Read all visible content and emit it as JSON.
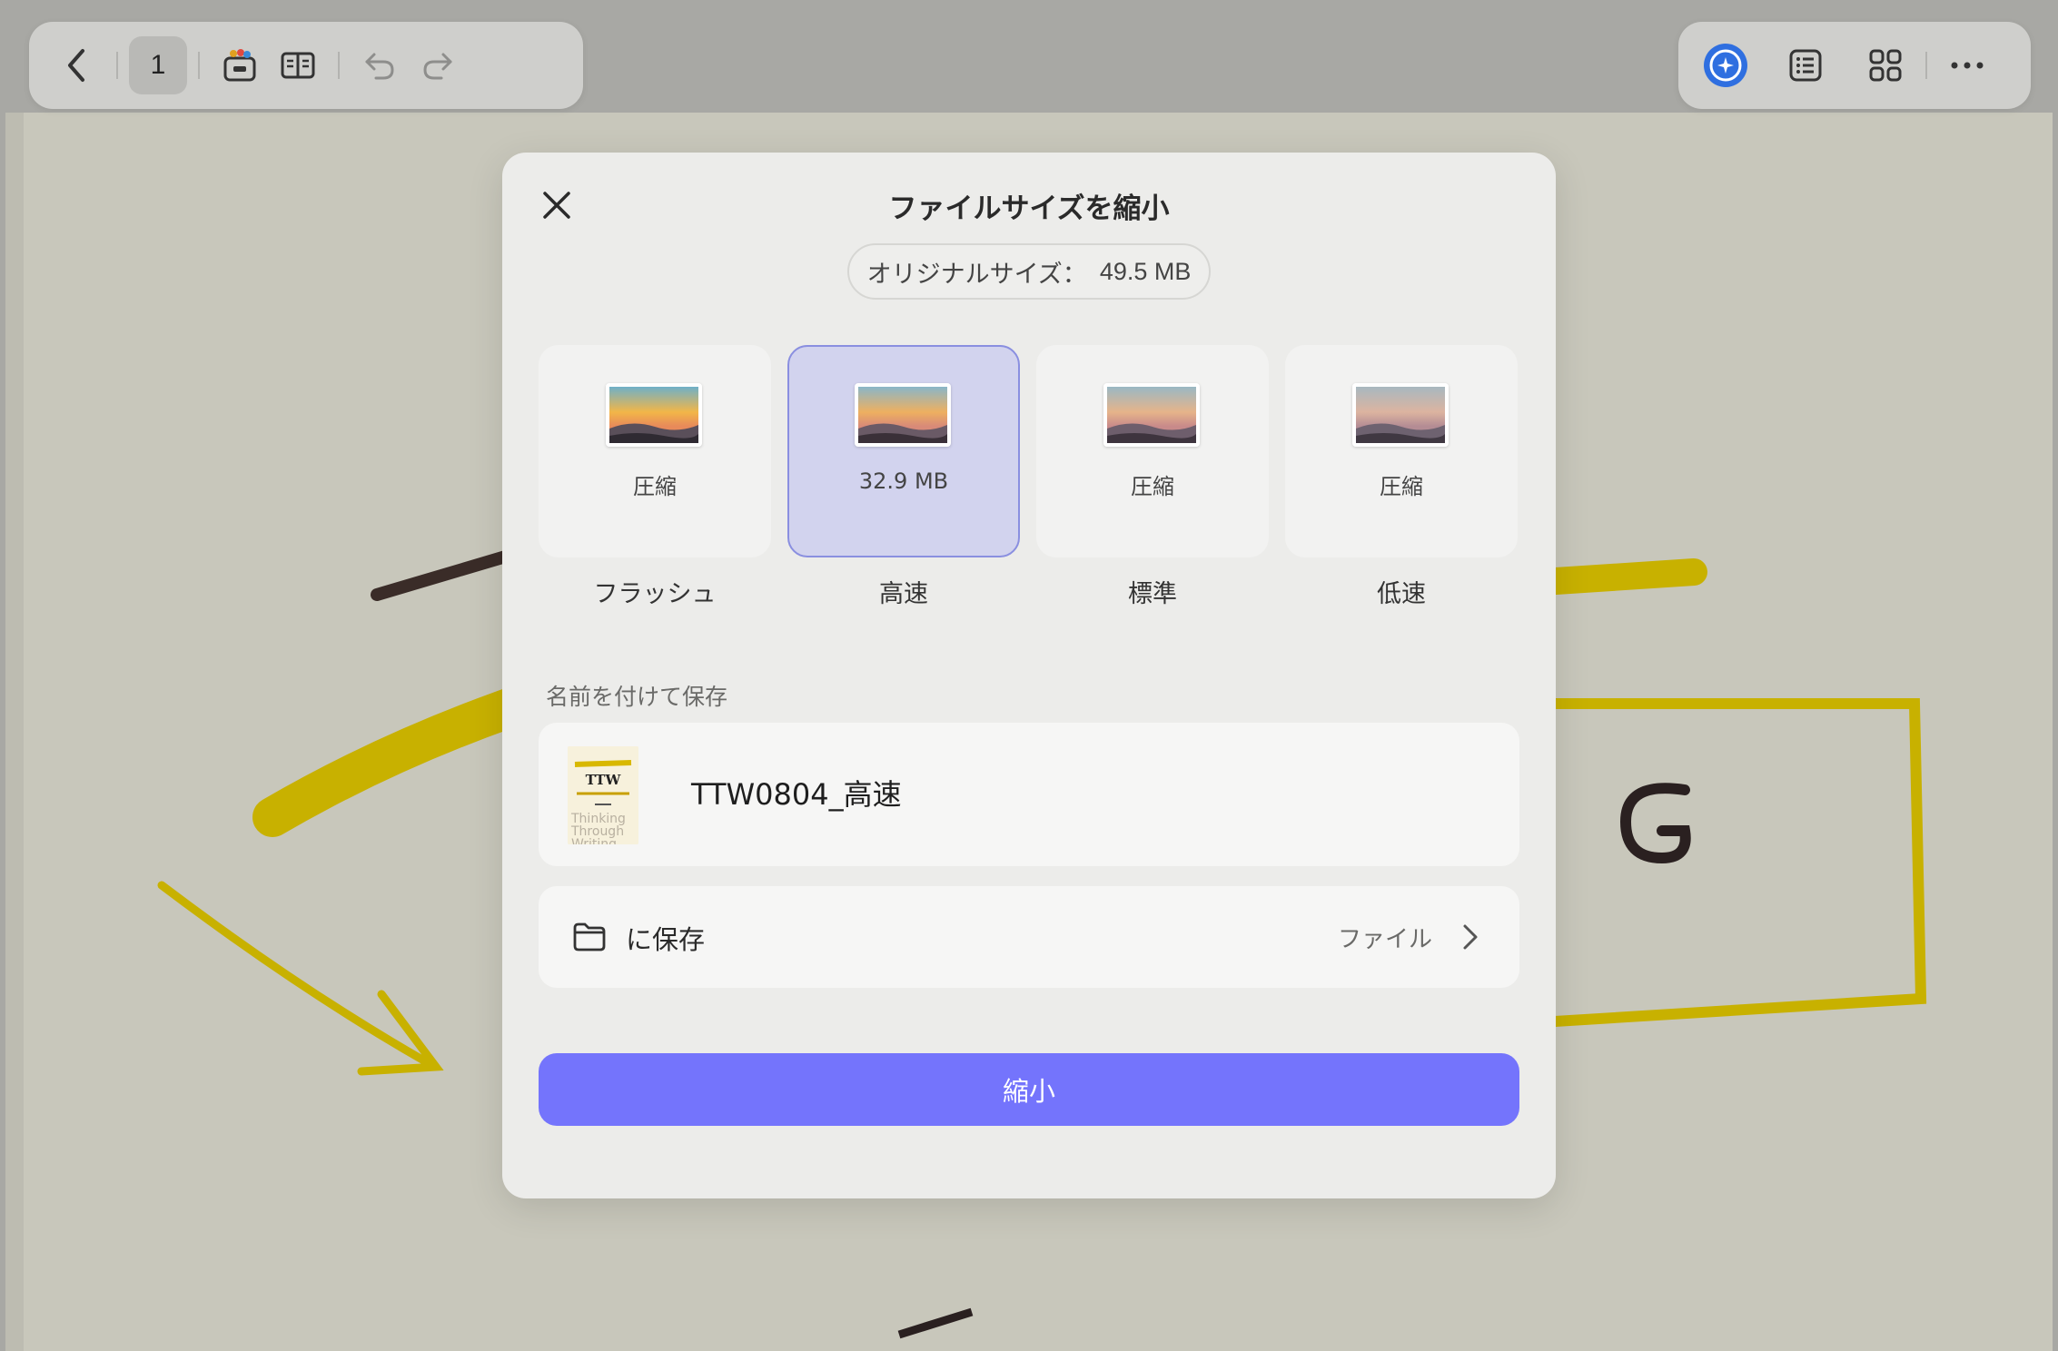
{
  "toolbar": {
    "page_number": "1",
    "icons": [
      "back-icon",
      "tray-icon",
      "book-icon",
      "undo-icon",
      "redo-icon",
      "ai-assistant-icon",
      "list-icon",
      "grid-icon",
      "more-icon"
    ]
  },
  "dialog": {
    "title": "ファイルサイズを縮小",
    "original_size_label": "オリジナルサイズ：",
    "original_size_value": "49.5 MB",
    "options": [
      {
        "size": "圧縮",
        "name": "フラッシュ",
        "selected": false
      },
      {
        "size": "32.9 MB",
        "name": "高速",
        "selected": true
      },
      {
        "size": "圧縮",
        "name": "標準",
        "selected": false
      },
      {
        "size": "圧縮",
        "name": "低速",
        "selected": false
      }
    ],
    "save_as_label": "名前を付けて保存",
    "filename": "TTW0804_高速",
    "file_thumbnail": {
      "logo": "TTW",
      "lines": [
        "Thinking",
        "Through",
        "Writing"
      ]
    },
    "save_location_label": "に保存",
    "save_location_value": "ファイル",
    "submit_label": "縮小"
  },
  "colors": {
    "accent": "#7474fc",
    "selected_card": "#d2d3ee",
    "selected_border": "#8a8fe0",
    "modal_bg": "#ececea"
  }
}
